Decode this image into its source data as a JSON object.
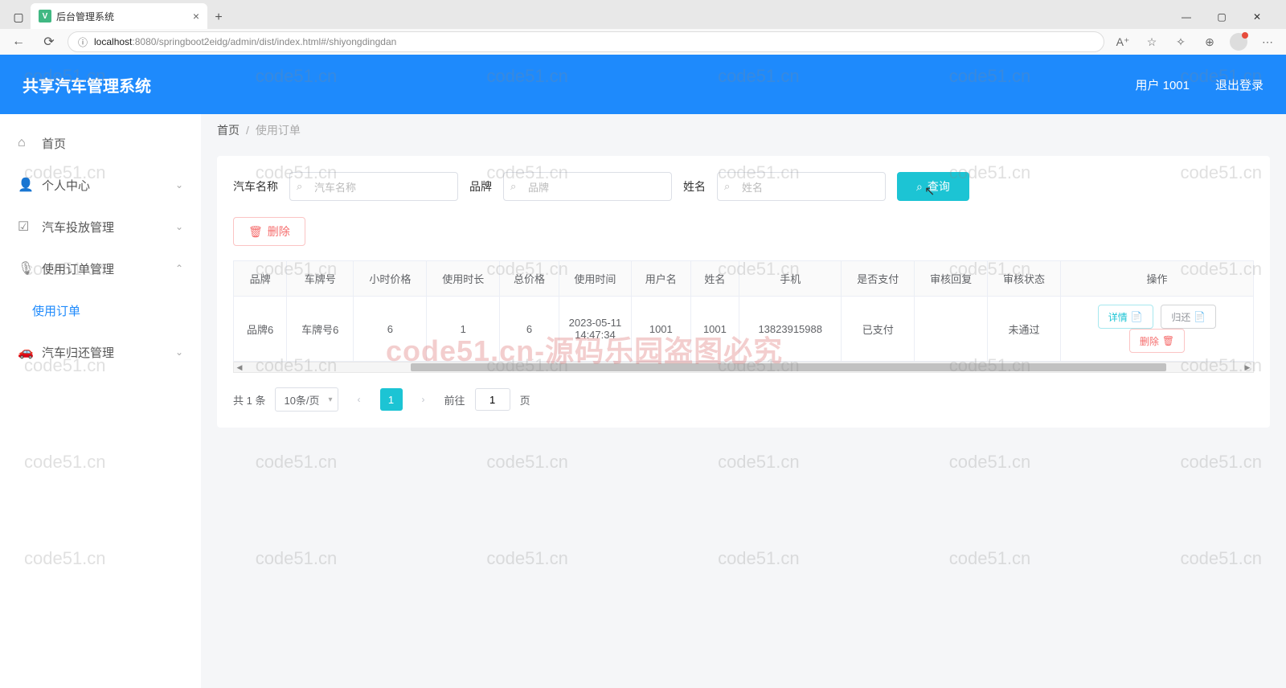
{
  "browser": {
    "tab_title": "后台管理系统",
    "url_host": "localhost",
    "url_port": ":8080",
    "url_path": "/springboot2eidg/admin/dist/index.html#/shiyongdingdan"
  },
  "header": {
    "app_title": "共享汽车管理系统",
    "user_label": "用户 1001",
    "logout_label": "退出登录"
  },
  "sidebar": {
    "items": [
      {
        "icon": "⌂",
        "label": "首页"
      },
      {
        "icon": "👤",
        "label": "个人中心",
        "expandable": true
      },
      {
        "icon": "☑",
        "label": "汽车投放管理",
        "expandable": true
      },
      {
        "icon": "🎙",
        "label": "使用订单管理",
        "expandable": true,
        "expanded": true
      },
      {
        "icon": "",
        "label": "使用订单",
        "sub": true,
        "active": true
      },
      {
        "icon": "🚗",
        "label": "汽车归还管理",
        "expandable": true
      }
    ]
  },
  "breadcrumb": {
    "home": "首页",
    "current": "使用订单"
  },
  "filters": {
    "car_name_label": "汽车名称",
    "car_name_placeholder": "汽车名称",
    "brand_label": "品牌",
    "brand_placeholder": "品牌",
    "name_label": "姓名",
    "name_placeholder": "姓名",
    "query_label": "查询",
    "delete_label": "删除"
  },
  "table": {
    "columns": [
      "品牌",
      "车牌号",
      "小时价格",
      "使用时长",
      "总价格",
      "使用时间",
      "用户名",
      "姓名",
      "手机",
      "是否支付",
      "审核回复",
      "审核状态",
      "操作"
    ],
    "rows": [
      {
        "brand": "品牌6",
        "plate": "车牌号6",
        "price_hour": "6",
        "duration": "1",
        "total": "6",
        "use_time": "2023-05-11 14:47:34",
        "username": "1001",
        "name": "1001",
        "phone": "13823915988",
        "paid": "已支付",
        "review_reply": "",
        "review_status": "未通过"
      }
    ],
    "actions": {
      "detail": "详情",
      "return": "归还",
      "delete": "删除"
    }
  },
  "pagination": {
    "total_text": "共 1 条",
    "page_size": "10条/页",
    "current_page": "1",
    "goto_prefix": "前往",
    "goto_value": "1",
    "goto_suffix": "页"
  },
  "watermark": {
    "small": "code51.cn",
    "big": "code51.cn-源码乐园盗图必究"
  }
}
